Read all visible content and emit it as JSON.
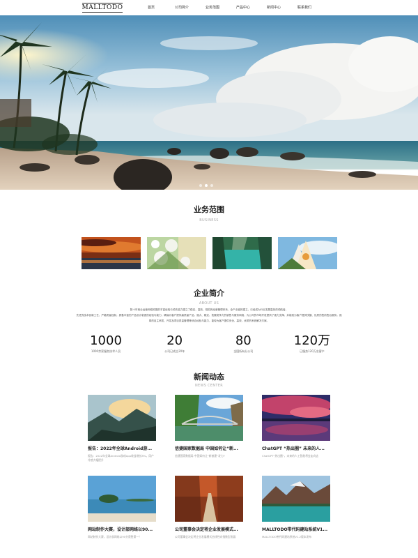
{
  "header": {
    "logo": "MALLTODO",
    "nav": [
      "首页",
      "公司简介",
      "业务范围",
      "产品中心",
      "新闻中心",
      "联系我们"
    ]
  },
  "hero": {
    "dots": 3,
    "active_dot": 1
  },
  "business": {
    "title": "业务范围",
    "subtitle": "BUSINESS",
    "items": [
      "sunset-lake-image",
      "white-flowers-image",
      "mountain-lake-image",
      "sky-flower-image"
    ]
  },
  "about": {
    "title": "企业简介",
    "subtitle": "ABOUT US",
    "paragraph1": "数十年商业运营网络拓展的丰富经验与领先能力建立了稳定、高效、规范的经营管理体系，全产业链的建立，已经成为行业发展高效的领航者。",
    "paragraph2": "先进的技术创新工艺，严格质量控制，具备丰富的产品设计制造的经验与能力，确保为客户提供高质量产品。强大、稳定、拓展竞争力的销售与服务网络，为公司的市场开发提供了强力支撑，并能较为客户提供快捷、优质的售前售后服务。强厚的自主研发、开发及项目质量管理等综合经验与能力，能较为客户提供安全、高效、优质的系统解决方案。",
    "stats": [
      {
        "number": "1000",
        "label": "1000余家服务技术人员"
      },
      {
        "number": "20",
        "label": "公司已成立20年"
      },
      {
        "number": "80",
        "label": "全国所有分公司"
      },
      {
        "number": "120万",
        "label": "已服务120万名客户"
      }
    ]
  },
  "news": {
    "title": "新闻动态",
    "subtitle": "NEWS CENTER",
    "items": [
      {
        "title": "报告：2022年全球Android游...",
        "desc": "报告：2022年全球Android游戏App收益增长8%，用户冷感大幅提升"
      },
      {
        "title": "信捷国家数据局 中国如何让“新...",
        "desc": "信捷国家数据局 中国如何让“新基建”发力?"
      },
      {
        "title": "ChatGPT “热出圈” 未来的人...",
        "desc": "ChatGPT“热出圈”，未来的人工智能将会走向这"
      },
      {
        "title": "网站制作大赛，设计部网络以90...",
        "desc": "网站制作大赛，设计部网络以90分获胜第一！"
      },
      {
        "title": "公司董事会决定将企业发展模式...",
        "desc": "公司董事会决定将企业发展模式由线性向指数型发展"
      },
      {
        "title": "MALLTODO带代码建站系统V1...",
        "desc": "MALLTODO带代码建站系统V1.2版本发布"
      }
    ]
  }
}
